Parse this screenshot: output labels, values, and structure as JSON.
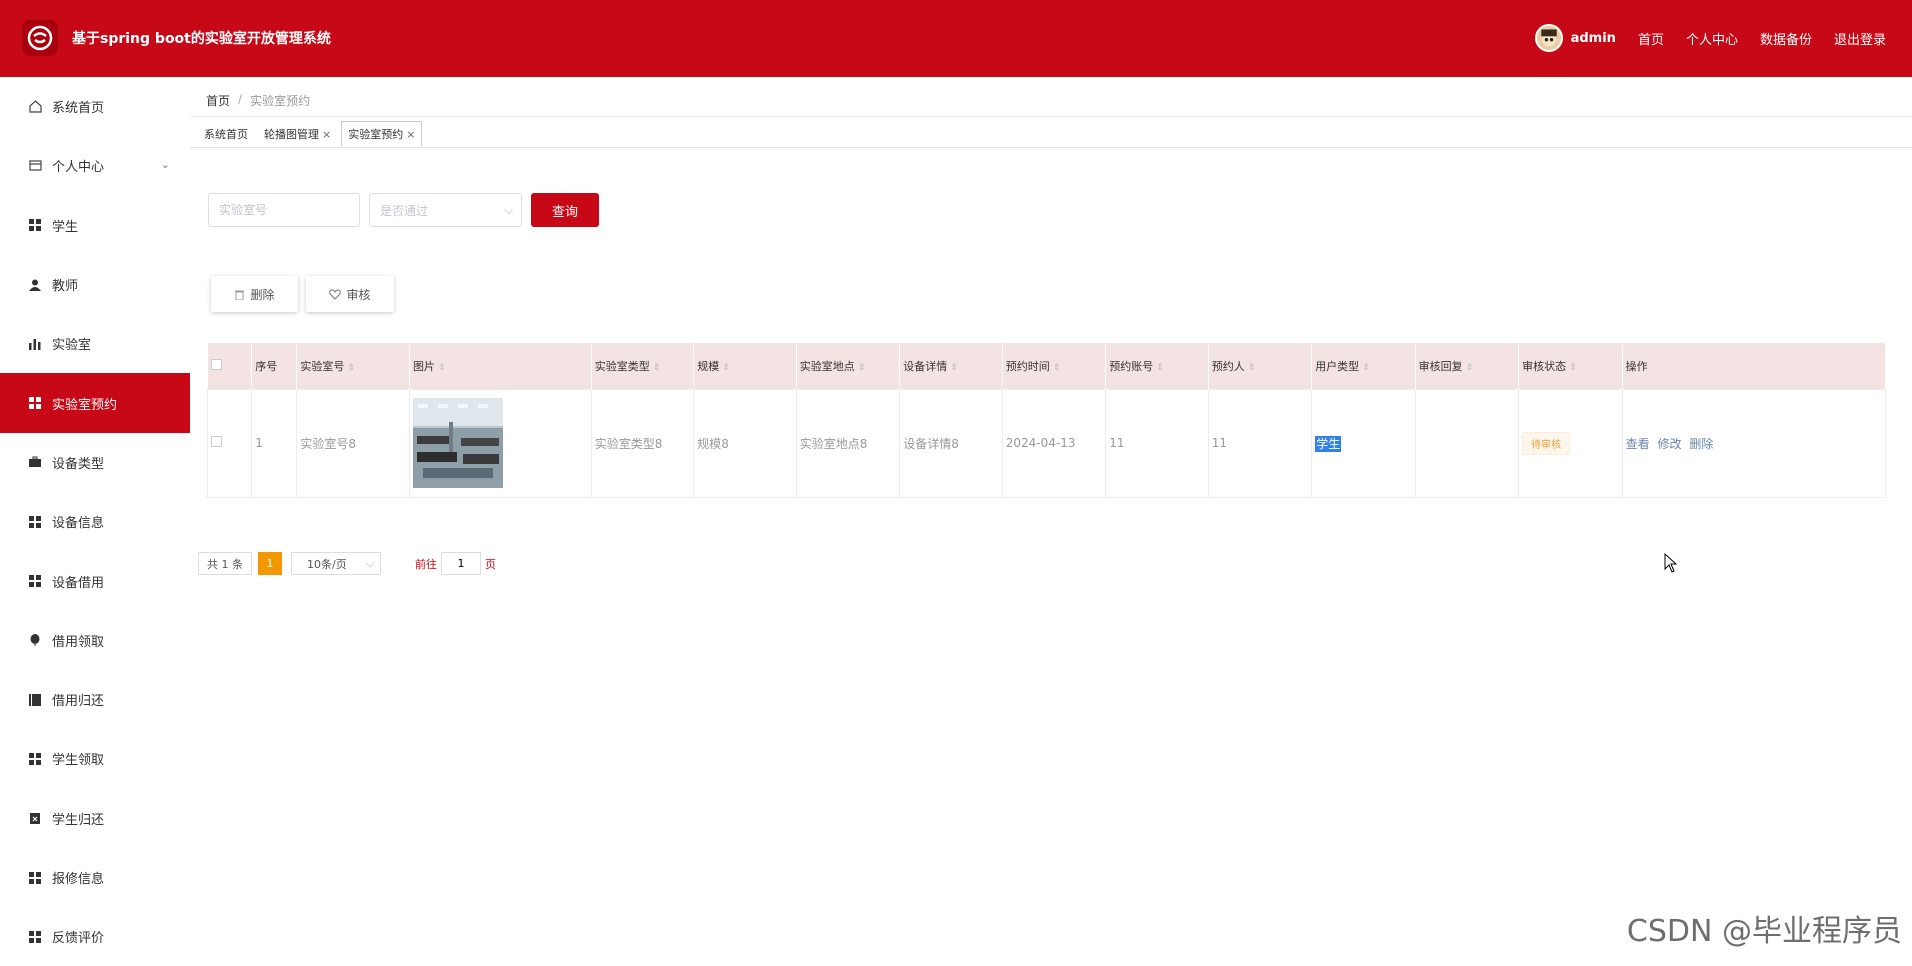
{
  "header": {
    "title": "基于spring boot的实验室开放管理系统",
    "username": "admin",
    "links": [
      "首页",
      "个人中心",
      "数据备份",
      "退出登录"
    ],
    "accent_color": "#c70817"
  },
  "sidebar": {
    "items": [
      {
        "label": "系统首页",
        "icon": "home-icon"
      },
      {
        "label": "个人中心",
        "icon": "profile-icon",
        "expandable": true
      },
      {
        "label": "学生",
        "icon": "grid-icon"
      },
      {
        "label": "教师",
        "icon": "person-icon"
      },
      {
        "label": "实验室",
        "icon": "bar-chart-icon"
      },
      {
        "label": "实验室预约",
        "icon": "grid-icon",
        "active": true
      },
      {
        "label": "设备类型",
        "icon": "briefcase-icon"
      },
      {
        "label": "设备信息",
        "icon": "grid-icon"
      },
      {
        "label": "设备借用",
        "icon": "grid-icon"
      },
      {
        "label": "借用领取",
        "icon": "balloon-icon"
      },
      {
        "label": "借用归还",
        "icon": "book-icon"
      },
      {
        "label": "学生领取",
        "icon": "grid-icon"
      },
      {
        "label": "学生归还",
        "icon": "clipboard-icon"
      },
      {
        "label": "报修信息",
        "icon": "grid-icon"
      },
      {
        "label": "反馈评价",
        "icon": "grid-icon"
      }
    ]
  },
  "breadcrumb": {
    "home": "首页",
    "sep": "/",
    "current": "实验室预约"
  },
  "tabs": [
    {
      "label": "系统首页",
      "closable": false
    },
    {
      "label": "轮播图管理",
      "closable": true
    },
    {
      "label": "实验室预约",
      "closable": true,
      "active": true
    }
  ],
  "search": {
    "lab_no_placeholder": "实验室号",
    "approved_placeholder": "是否通过",
    "query_label": "查询"
  },
  "actions": {
    "delete_label": "删除",
    "audit_label": "审核"
  },
  "table": {
    "columns": [
      "序号",
      "实验室号",
      "图片",
      "实验室类型",
      "规模",
      "实验室地点",
      "设备详情",
      "预约时间",
      "预约账号",
      "预约人",
      "用户类型",
      "审核回复",
      "审核状态",
      "操作"
    ],
    "rows": [
      {
        "index": "1",
        "lab_no": "实验室号8",
        "lab_type": "实验室类型8",
        "scale": "规模8",
        "location": "实验室地点8",
        "equipment": "设备详情8",
        "time": "2024-04-13",
        "account": "11",
        "person": "11",
        "user_type": "学生",
        "reply": "",
        "status": "待审核",
        "ops": [
          "查看",
          "修改",
          "删除"
        ]
      }
    ]
  },
  "pagination": {
    "total": "共 1 条",
    "current_page": "1",
    "page_size": "10条/页",
    "goto_label": "前往",
    "goto_value": "1",
    "page_suffix": "页"
  },
  "watermark": "CSDN @毕业程序员"
}
